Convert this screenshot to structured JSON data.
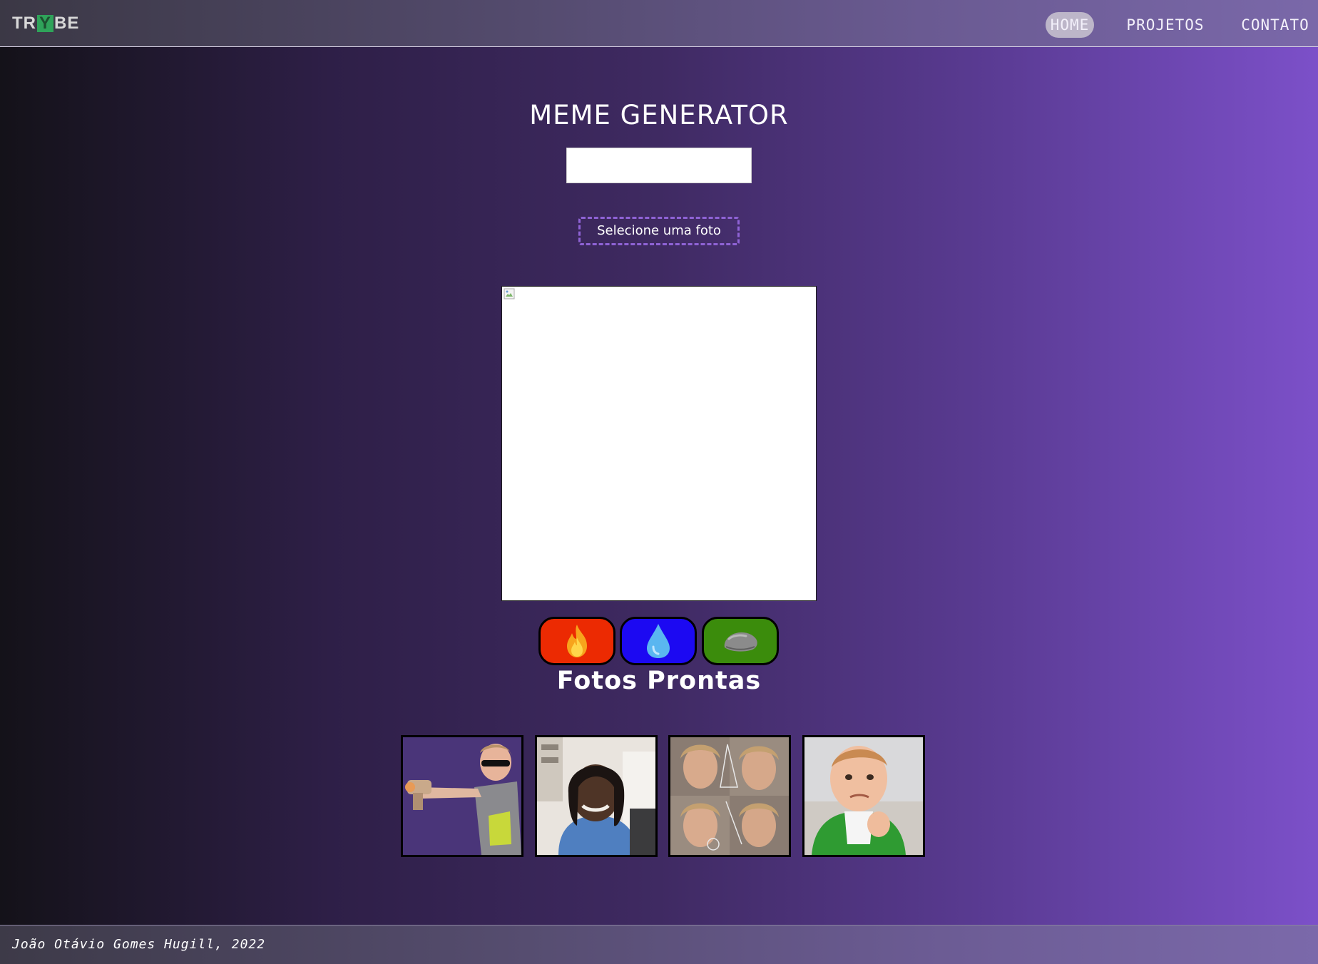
{
  "header": {
    "logo_left": "TR",
    "logo_y": "Y",
    "logo_right": "BE",
    "nav": [
      "HOME",
      "PROJETOS",
      "CONTATO"
    ]
  },
  "main": {
    "title": "MEME GENERATOR",
    "text_input_value": "",
    "upload_label": "Selecione uma foto",
    "theme_buttons": [
      {
        "icon": "fire-icon",
        "color": "#ec2a02"
      },
      {
        "icon": "water-drop-icon",
        "color": "#1c09f2"
      },
      {
        "icon": "rock-icon",
        "color": "#3b8c0c"
      }
    ],
    "gallery_title": "Fotos Prontas",
    "gallery": [
      {
        "icon": "meme-kid-sunglasses-gun-photo"
      },
      {
        "icon": "meme-woman-smiling-photo"
      },
      {
        "icon": "meme-math-lady-photo"
      },
      {
        "icon": "meme-success-kid-photo"
      }
    ]
  },
  "footer": {
    "credit": "João Otávio Gomes Hugill, 2022"
  }
}
